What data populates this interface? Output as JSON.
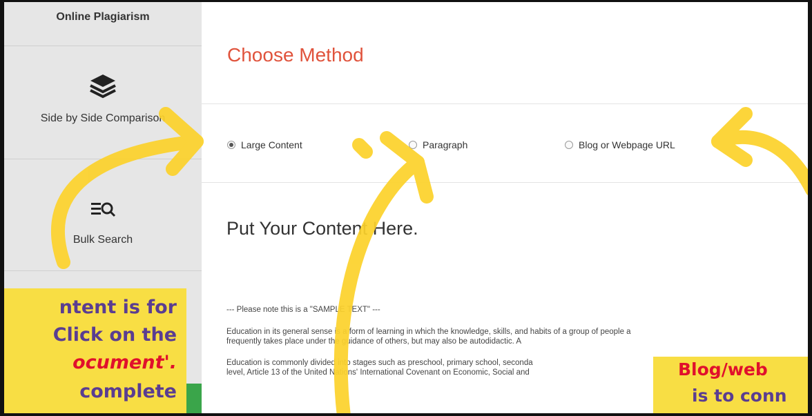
{
  "sidebar": {
    "top_item": "Online Plagiarism",
    "compare_label": "Side by Side Comparison",
    "compare_icon": "layers-icon",
    "bulk_label": "Bulk Search",
    "bulk_icon": "list-search-icon"
  },
  "main": {
    "title": "Choose Method",
    "methods": [
      {
        "label": "Large Content",
        "selected": true
      },
      {
        "label": "Paragraph",
        "selected": false
      },
      {
        "label": "Blog or Webpage URL",
        "selected": false
      }
    ],
    "content_heading": "Put Your Content Here.",
    "sample_note": "--- Please note this is a \"SAMPLE TEXT\" ---",
    "para1_line1": "Education in its general sense is a form of learning in which the knowledge, skills, and habits of a group of people a",
    "para1_line2": "frequently takes place under the guidance of others, but may also be autodidactic. A",
    "para2_line1": "Education is commonly divided into stages such as preschool, primary school, seconda",
    "para2_line2": "level, Article 13 of the United Nations' International Covenant on Economic, Social and"
  },
  "callout_left": {
    "line1": "ntent is for",
    "line2": "Click on the",
    "line3": "ocument'.",
    "line4": "complete"
  },
  "callout_right": {
    "line1": "Blog/web",
    "line2": "is to conn"
  },
  "colors": {
    "title_red": "#e0533c",
    "callout_yellow": "#f8de44",
    "callout_purple": "#5a3d91",
    "callout_red": "#e0102c",
    "arrow_yellow": "#fcd22c"
  }
}
